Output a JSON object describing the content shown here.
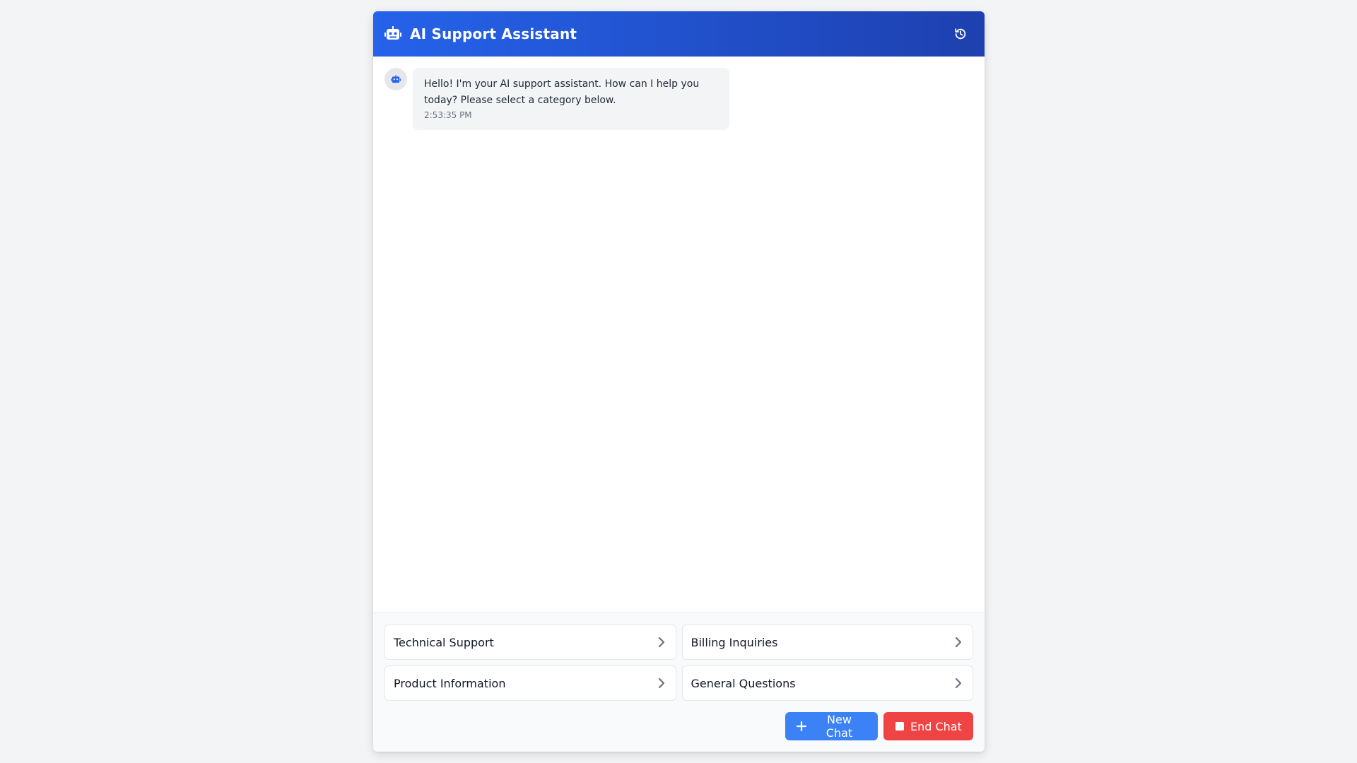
{
  "header": {
    "title": "AI Support Assistant",
    "icon": "robot-icon",
    "history_icon": "history-icon"
  },
  "messages": [
    {
      "sender": "bot",
      "text": "Hello! I'm your AI support assistant. How can I help you today? Please select a category below.",
      "time": "2:53:35 PM"
    }
  ],
  "categories": [
    {
      "label": "Technical Support"
    },
    {
      "label": "Billing Inquiries"
    },
    {
      "label": "Product Information"
    },
    {
      "label": "General Questions"
    }
  ],
  "actions": {
    "new_chat": "New Chat",
    "end_chat": "End Chat"
  },
  "colors": {
    "header_start": "#2563eb",
    "header_end": "#1e40af",
    "new_chat": "#3b82f6",
    "end_chat": "#ef4444"
  }
}
